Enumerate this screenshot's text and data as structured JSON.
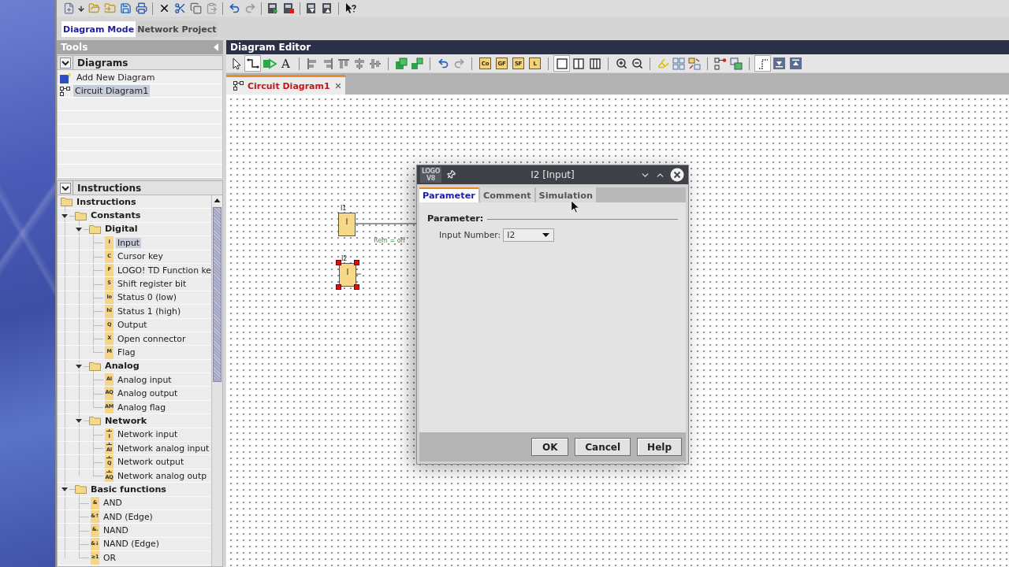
{
  "mode_tabs": [
    {
      "label": "Diagram Mode",
      "selected": true
    },
    {
      "label": "Network Project",
      "selected": false
    }
  ],
  "tools_panel": {
    "title": "Tools",
    "diagrams": {
      "title": "Diagrams",
      "expanded": true,
      "items": [
        {
          "label": "Add New Diagram",
          "kind": "add",
          "selected": false
        },
        {
          "label": "Circuit Diagram1",
          "kind": "diagram",
          "selected": true
        }
      ]
    }
  },
  "instructions_panel": {
    "title": "Instructions",
    "expanded": true,
    "tree": [
      {
        "label": "Instructions",
        "kind": "folder",
        "expanded": true,
        "selected": false,
        "children": [
          {
            "label": "Constants",
            "kind": "folder",
            "expanded": true,
            "selected": false,
            "children": [
              {
                "label": "Digital",
                "kind": "folder",
                "expanded": true,
                "selected": false,
                "children": [
                  {
                    "label": "Input",
                    "kind": "block",
                    "badge": "I",
                    "selected": true
                  },
                  {
                    "label": "Cursor key",
                    "kind": "block",
                    "badge": "C",
                    "selected": false
                  },
                  {
                    "label": "LOGO! TD Function ke",
                    "kind": "block",
                    "badge": "F",
                    "selected": false
                  },
                  {
                    "label": "Shift register bit",
                    "kind": "block",
                    "badge": "S",
                    "selected": false
                  },
                  {
                    "label": "Status 0 (low)",
                    "kind": "block",
                    "badge": "lo",
                    "selected": false
                  },
                  {
                    "label": "Status 1 (high)",
                    "kind": "block",
                    "badge": "hi",
                    "selected": false
                  },
                  {
                    "label": "Output",
                    "kind": "block",
                    "badge": "Q",
                    "selected": false
                  },
                  {
                    "label": "Open connector",
                    "kind": "block",
                    "badge": "X",
                    "selected": false
                  },
                  {
                    "label": "Flag",
                    "kind": "block",
                    "badge": "M",
                    "selected": false
                  }
                ]
              },
              {
                "label": "Analog",
                "kind": "folder",
                "expanded": true,
                "selected": false,
                "children": [
                  {
                    "label": "Analog input",
                    "kind": "block",
                    "badge": "AI",
                    "selected": false
                  },
                  {
                    "label": "Analog output",
                    "kind": "block",
                    "badge": "AQ",
                    "selected": false
                  },
                  {
                    "label": "Analog flag",
                    "kind": "block",
                    "badge": "AM",
                    "selected": false
                  }
                ]
              },
              {
                "label": "Network",
                "kind": "folder",
                "expanded": true,
                "selected": false,
                "children": [
                  {
                    "label": "Network input",
                    "kind": "network",
                    "badge": "I",
                    "selected": false
                  },
                  {
                    "label": "Network analog input",
                    "kind": "network",
                    "badge": "AI",
                    "selected": false
                  },
                  {
                    "label": "Network output",
                    "kind": "network",
                    "badge": "Q",
                    "selected": false
                  },
                  {
                    "label": "Network analog outp",
                    "kind": "network",
                    "badge": "AQ",
                    "selected": false
                  }
                ]
              }
            ]
          },
          {
            "label": "Basic functions",
            "kind": "folder",
            "expanded": true,
            "selected": false,
            "children": [
              {
                "label": "AND",
                "kind": "block",
                "badge": "&",
                "selected": false
              },
              {
                "label": "AND (Edge)",
                "kind": "block",
                "badge": "&↑",
                "selected": false
              },
              {
                "label": "NAND",
                "kind": "block",
                "badge": "&.",
                "selected": false
              },
              {
                "label": "NAND (Edge)",
                "kind": "block",
                "badge": "&↓",
                "selected": false
              },
              {
                "label": "OR",
                "kind": "block",
                "badge": "≥1",
                "selected": false
              }
            ]
          }
        ]
      }
    ]
  },
  "editor": {
    "title": "Diagram Editor",
    "toolbar": {
      "tools": [
        {
          "selected": false
        },
        {
          "selected": true
        },
        {
          "selected": false
        },
        {
          "label": "A",
          "selected": false
        }
      ],
      "block_buttons": [
        "Co",
        "GF",
        "SF",
        "L"
      ],
      "layout_buttons": [
        {
          "selected": true
        },
        {
          "selected": false
        },
        {
          "selected": false
        }
      ],
      "route_buttons": [
        {
          "selected": true
        },
        {
          "selected": false
        },
        {
          "selected": false
        }
      ]
    },
    "tabs": [
      {
        "label": "Circuit Diagram1",
        "selected": true
      }
    ],
    "canvas": {
      "blocks": [
        {
          "name": "I1",
          "symbol": "I",
          "selected": false
        },
        {
          "name": "I2",
          "symbol": "I",
          "selected": true
        }
      ],
      "annotation": "Rem = off"
    }
  },
  "dialog": {
    "title": "I2 [Input]",
    "logo": {
      "top": "LOGO",
      "bottom": "V8"
    },
    "tabs": [
      {
        "label": "Parameter",
        "selected": true
      },
      {
        "label": "Comment",
        "selected": false
      },
      {
        "label": "Simulation",
        "selected": false
      }
    ],
    "section": "Parameter:",
    "field": {
      "label": "Input Number:",
      "value": "I2"
    },
    "buttons": [
      "OK",
      "Cancel",
      "Help"
    ]
  }
}
